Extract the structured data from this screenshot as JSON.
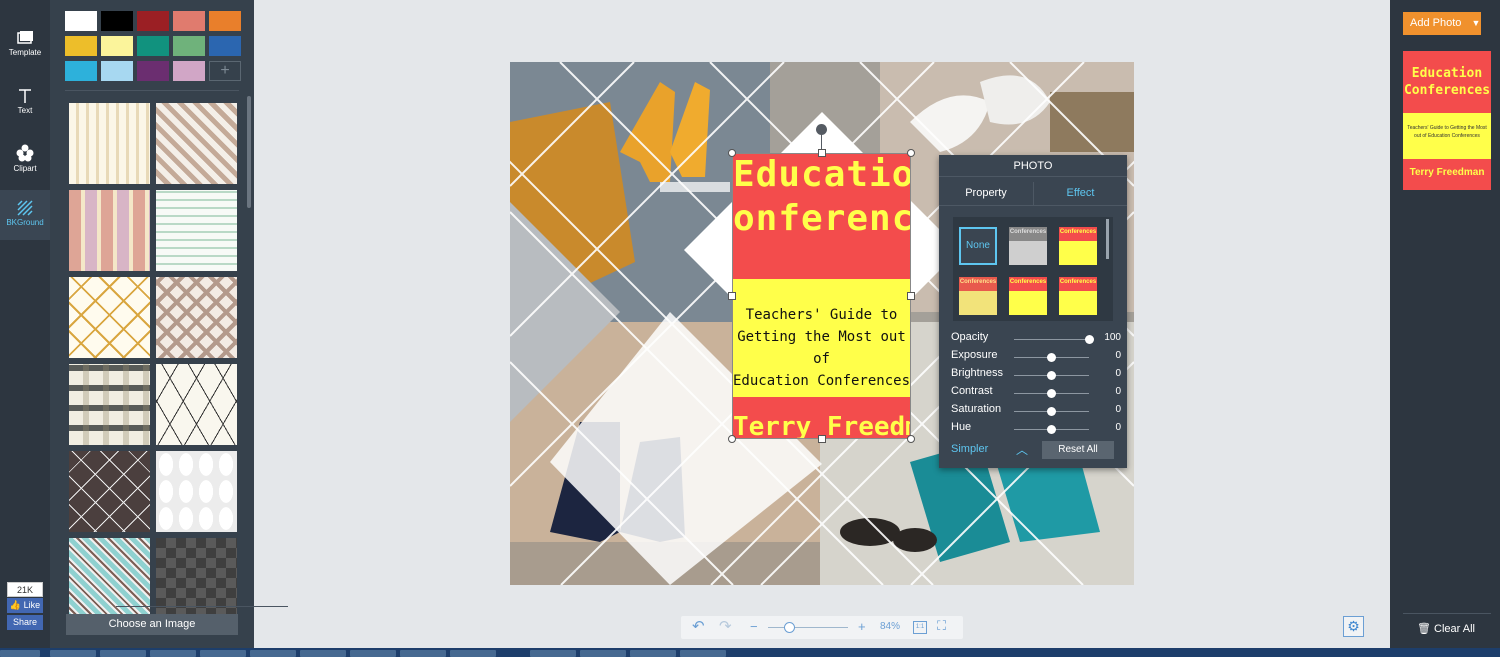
{
  "leftnav": {
    "items": [
      {
        "label": "Template",
        "icon": "template-icon"
      },
      {
        "label": "Text",
        "icon": "text-icon"
      },
      {
        "label": "Clipart",
        "icon": "clipart-icon"
      },
      {
        "label": "BKGround",
        "icon": "background-icon"
      }
    ],
    "active": "BKGround"
  },
  "social": {
    "count": "21K",
    "like_label": "Like",
    "share_label": "Share"
  },
  "leftpanel": {
    "swatch_colors": [
      "#ffffff",
      "#000000",
      "#9b1f24",
      "#e07b6e",
      "#e97f2b",
      "#edbe2a",
      "#fbf49b",
      "#11927e",
      "#6fb27b",
      "#2b66b0",
      "#2db1db",
      "#a7d8f1",
      "#6b2e70",
      "#d1a6c6"
    ],
    "add_color_label": "+",
    "choose_image_label": "Choose an Image"
  },
  "canvas": {
    "text_box": {
      "title_line1": "Education",
      "title_line2": "onference",
      "subtitle_lines": [
        "Teachers' Guide to",
        "Getting the Most out of",
        "Education Conferences"
      ],
      "author": "Terry Freedman"
    }
  },
  "photo_panel": {
    "title": "PHOTO",
    "tabs": [
      "Property",
      "Effect"
    ],
    "active_tab": "Property",
    "none_label": "None",
    "effect_thumb_label": "Conferences",
    "sliders": [
      {
        "label": "Opacity",
        "value": "100"
      },
      {
        "label": "Exposure",
        "value": "0"
      },
      {
        "label": "Brightness",
        "value": "0"
      },
      {
        "label": "Contrast",
        "value": "0"
      },
      {
        "label": "Saturation",
        "value": "0"
      },
      {
        "label": "Hue",
        "value": "0"
      }
    ],
    "slider_fractions": [
      1.0,
      0.5,
      0.5,
      0.5,
      0.5,
      0.5
    ],
    "simpler_label": "Simpler",
    "reset_label": "Reset All"
  },
  "bottombar": {
    "zoom": "84%",
    "one_to_one_label": "1:1"
  },
  "rightpanel": {
    "add_photo_label": "Add Photo",
    "page_thumb": {
      "title": "Education Conferences",
      "subtitle": "Teachers' Guide to Getting the Most out of Education Conferences",
      "author": "Terry Freedman"
    },
    "clear_all_label": "Clear All"
  },
  "colors": {
    "accent": "#5ec6f0",
    "orange": "#f0912d",
    "poster_red": "#f34c4c",
    "poster_yellow": "#ffff4a"
  }
}
